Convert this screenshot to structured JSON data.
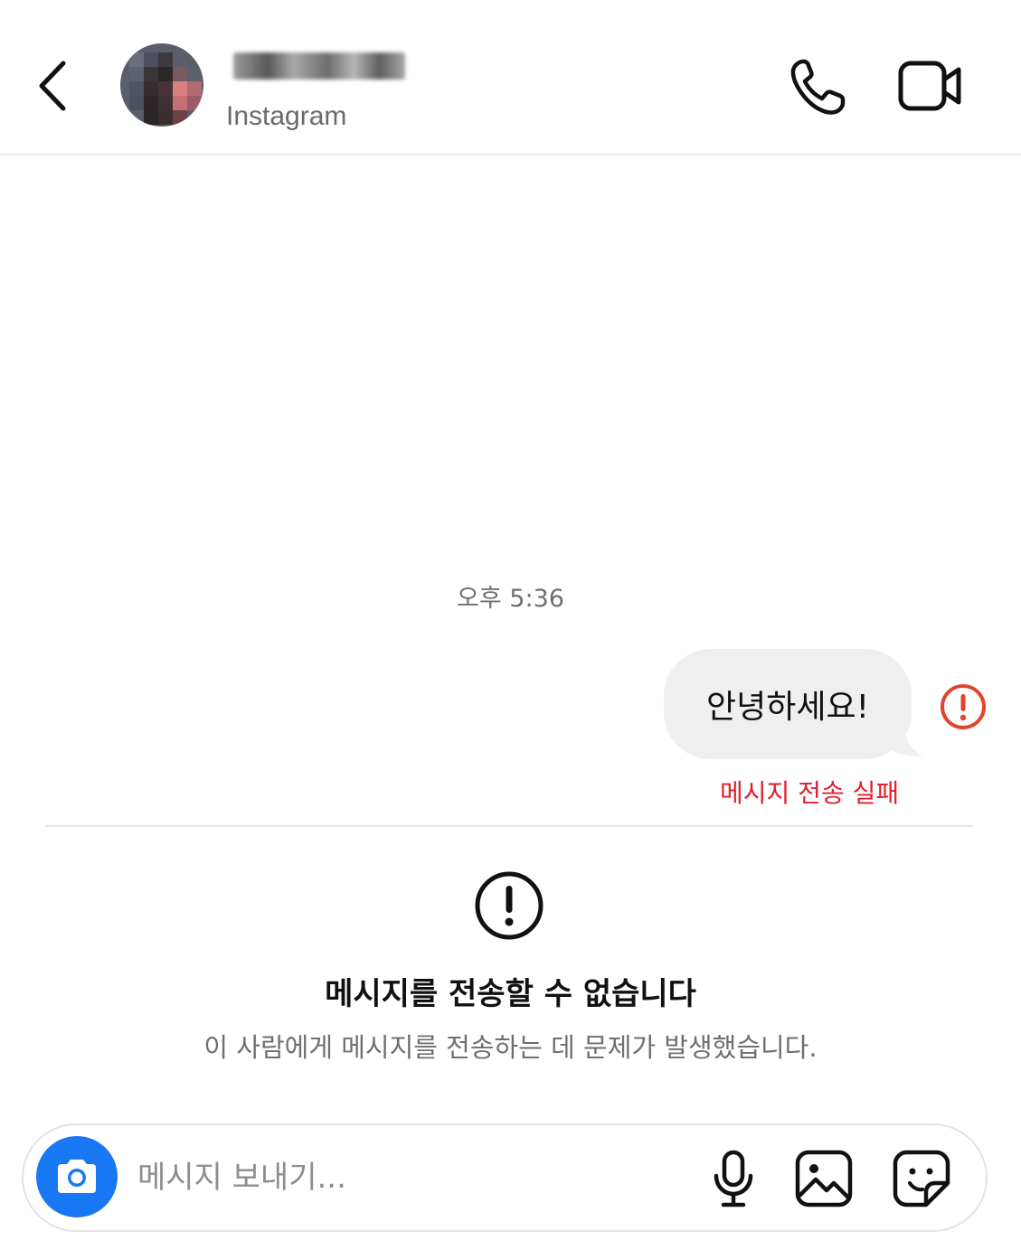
{
  "header": {
    "subtitle": "Instagram",
    "icons": {
      "back": "chevron-left-icon",
      "call": "phone-icon",
      "video": "video-camera-icon"
    }
  },
  "thread": {
    "timestamp": "오후 5:36",
    "messages": [
      {
        "text": "안녕하세요!",
        "sent": true,
        "status": "메시지 전송 실패"
      }
    ]
  },
  "notice": {
    "title": "메시지를 전송할 수 없습니다",
    "body": "이 사람에게 메시지를 전송하는 데 문제가 발생했습니다."
  },
  "composer": {
    "placeholder": "메시지 보내기...",
    "icons": [
      "camera-icon",
      "microphone-icon",
      "gallery-icon",
      "sticker-icon"
    ]
  },
  "colors": {
    "accent": "#1877f2",
    "error": "#e41d2b",
    "bubble": "#efefef"
  }
}
